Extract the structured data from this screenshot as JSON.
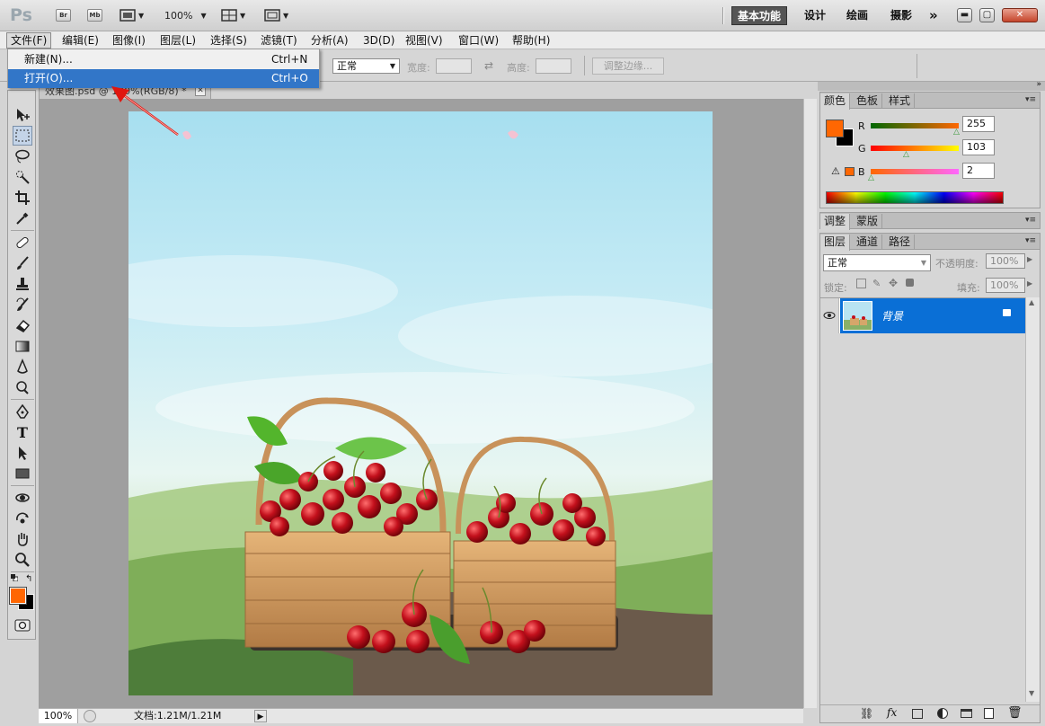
{
  "app": {
    "logo": "Ps",
    "bridge_label": "Br",
    "minibridge_label": "Mb",
    "zoom": "100%",
    "workspaces": [
      "基本功能",
      "设计",
      "绘画",
      "摄影"
    ],
    "more": "»"
  },
  "menu": [
    "文件(F)",
    "编辑(E)",
    "图像(I)",
    "图层(L)",
    "选择(S)",
    "滤镜(T)",
    "分析(A)",
    "3D(D)",
    "视图(V)",
    "窗口(W)",
    "帮助(H)"
  ],
  "file_menu": {
    "items": [
      {
        "label": "新建(N)...",
        "shortcut": "Ctrl+N"
      },
      {
        "label": "打开(O)...",
        "shortcut": "Ctrl+O"
      }
    ],
    "highlighted_index": 1
  },
  "options": {
    "style_value": "正常",
    "width_label": "宽度:",
    "height_label": "高度:",
    "refine_button": "调整边缘..."
  },
  "document": {
    "tab_title": "效果图.psd @ 100%(RGB/8) *",
    "status_zoom": "100%",
    "status_doc": "文档:1.21M/1.21M"
  },
  "color_panel": {
    "tabs": [
      "颜色",
      "色板",
      "样式"
    ],
    "channels": [
      {
        "name": "R",
        "value": "255"
      },
      {
        "name": "G",
        "value": "103"
      },
      {
        "name": "B",
        "value": "2"
      }
    ],
    "foreground": "#ff6702",
    "background": "#000000"
  },
  "adjust_panel": {
    "tabs": [
      "调整",
      "蒙版"
    ]
  },
  "layers_panel": {
    "tabs": [
      "图层",
      "通道",
      "路径"
    ],
    "blend_mode": "正常",
    "opacity_label": "不透明度:",
    "opacity_value": "100%",
    "lock_label": "锁定:",
    "fill_label": "填充:",
    "fill_value": "100%",
    "layers": [
      {
        "name": "背景",
        "locked": true,
        "visible": true
      }
    ]
  },
  "colors": {
    "accent": "#3276c8",
    "selected_layer": "#0a6fd6"
  }
}
